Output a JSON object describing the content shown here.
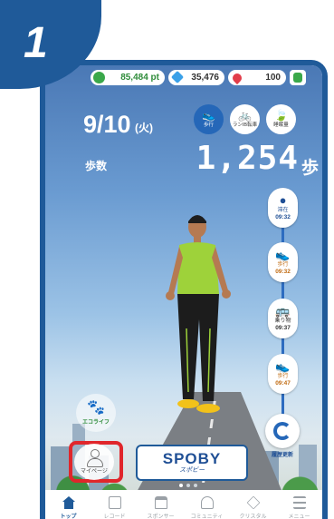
{
  "step": {
    "number": "1"
  },
  "status": {
    "points": "85,484 pt",
    "gems": "35,476",
    "drops": "100"
  },
  "header": {
    "date": "9/10",
    "weekday": "(火)",
    "modes": [
      {
        "label": "歩行",
        "icon": "shoe-icon",
        "active": true
      },
      {
        "label": "ランIB転車",
        "icon": "bicycle-run-icon",
        "active": false
      },
      {
        "label": "睡眠量",
        "icon": "leaf-icon",
        "active": false
      }
    ]
  },
  "steps": {
    "label": "歩数",
    "value": "1,254",
    "unit": "歩"
  },
  "timeline": [
    {
      "label": "滞在",
      "time": "09:32",
      "icon": "pin-icon"
    },
    {
      "label": "歩行",
      "time": "09:32",
      "icon": "shoe-icon"
    },
    {
      "label": "乗り物",
      "time": "09:37",
      "icon": "bus-icon"
    },
    {
      "label": "歩行",
      "time": "09:47",
      "icon": "shoe-icon"
    }
  ],
  "refresh": {
    "label": "履歴更新"
  },
  "eco": {
    "label": "エコライフ"
  },
  "mypage": {
    "label": "マイページ"
  },
  "spoby": {
    "title": "SPOBY",
    "subtitle": "スポビー"
  },
  "tabs": [
    {
      "label": "トップ",
      "active": true
    },
    {
      "label": "レコード",
      "active": false
    },
    {
      "label": "スポンサー",
      "active": false
    },
    {
      "label": "コミュニティ",
      "active": false
    },
    {
      "label": "クリスタル",
      "active": false
    },
    {
      "label": "メニュー",
      "active": false
    }
  ],
  "colors": {
    "brand_blue": "#1f5a99",
    "highlight_red": "#e0262b",
    "points_green": "#2f8c3a",
    "walk_orange": "#e8a020"
  }
}
